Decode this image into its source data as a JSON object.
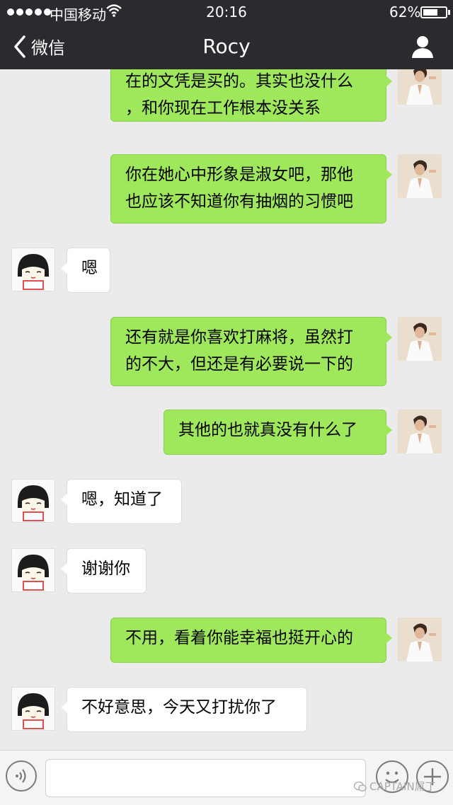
{
  "status_bar": {
    "carrier": "中国移动",
    "time": "20:16",
    "battery": "62%",
    "battery_level": 0.62
  },
  "nav": {
    "back_label": "微信",
    "title": "Rocy"
  },
  "messages": [
    {
      "side": "right",
      "lines": [
        "在的文凭是买的。其实也没什么",
        "，和你现在工作根本没关系"
      ]
    },
    {
      "side": "right",
      "lines": [
        "你在她心中形象是淑女吧，那他",
        "也应该不知道你有抽烟的习惯吧"
      ]
    },
    {
      "side": "left",
      "lines": [
        "嗯"
      ]
    },
    {
      "side": "right",
      "lines": [
        "还有就是你喜欢打麻将，虽然打",
        "的不大，但还是有必要说一下的"
      ]
    },
    {
      "side": "right",
      "lines": [
        "其他的也就真没有什么了"
      ]
    },
    {
      "side": "left",
      "lines": [
        "嗯，知道了"
      ]
    },
    {
      "side": "left",
      "lines": [
        "谢谢你"
      ]
    },
    {
      "side": "right",
      "lines": [
        "不用，看着你能幸福也挺开心的"
      ]
    },
    {
      "side": "left",
      "lines": [
        "不好意思，今天又打扰你了"
      ]
    }
  ],
  "input": {
    "placeholder": ""
  },
  "watermark": "CAPTAIN屌丁"
}
